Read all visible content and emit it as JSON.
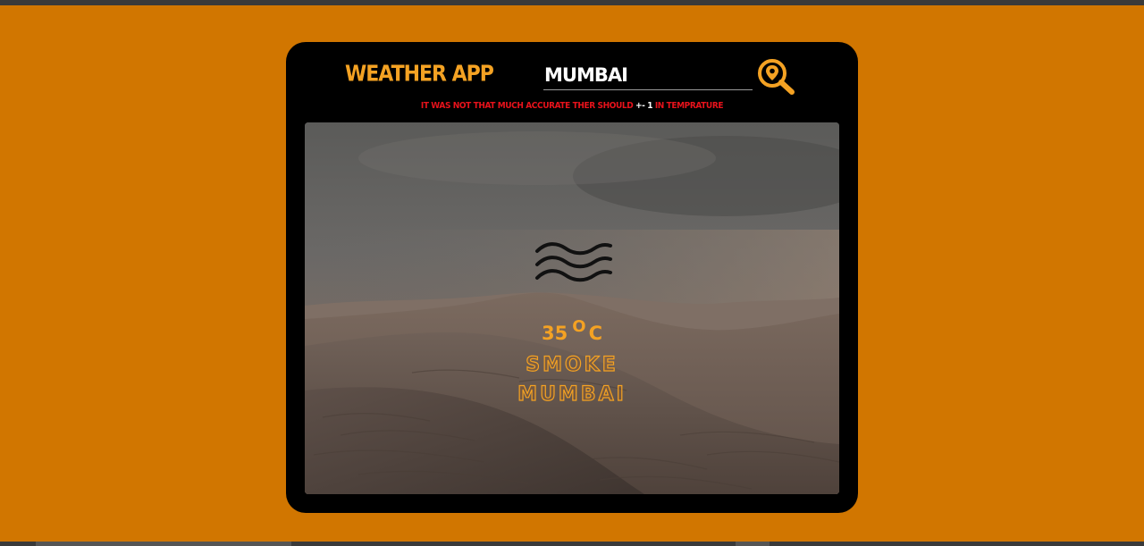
{
  "app": {
    "title": "WEATHER APP"
  },
  "search": {
    "value": "MUMBAI",
    "button_icon": "search-location-icon"
  },
  "note": {
    "before": "IT WAS NOT THAT MUCH ACCURATE THER SHOULD ",
    "highlight": "+- 1",
    "after": " IN TEMPRATURE"
  },
  "weather": {
    "icon": "fog-waves-icon",
    "temperature_value": "35",
    "degree_symbol": "O",
    "temperature_unit": "C",
    "condition": "SMOKE",
    "city": "MUMBAI"
  },
  "colors": {
    "page_background": "#d17600",
    "card_background": "#000000",
    "accent": "#f4a223",
    "note_red": "#e8121b"
  }
}
